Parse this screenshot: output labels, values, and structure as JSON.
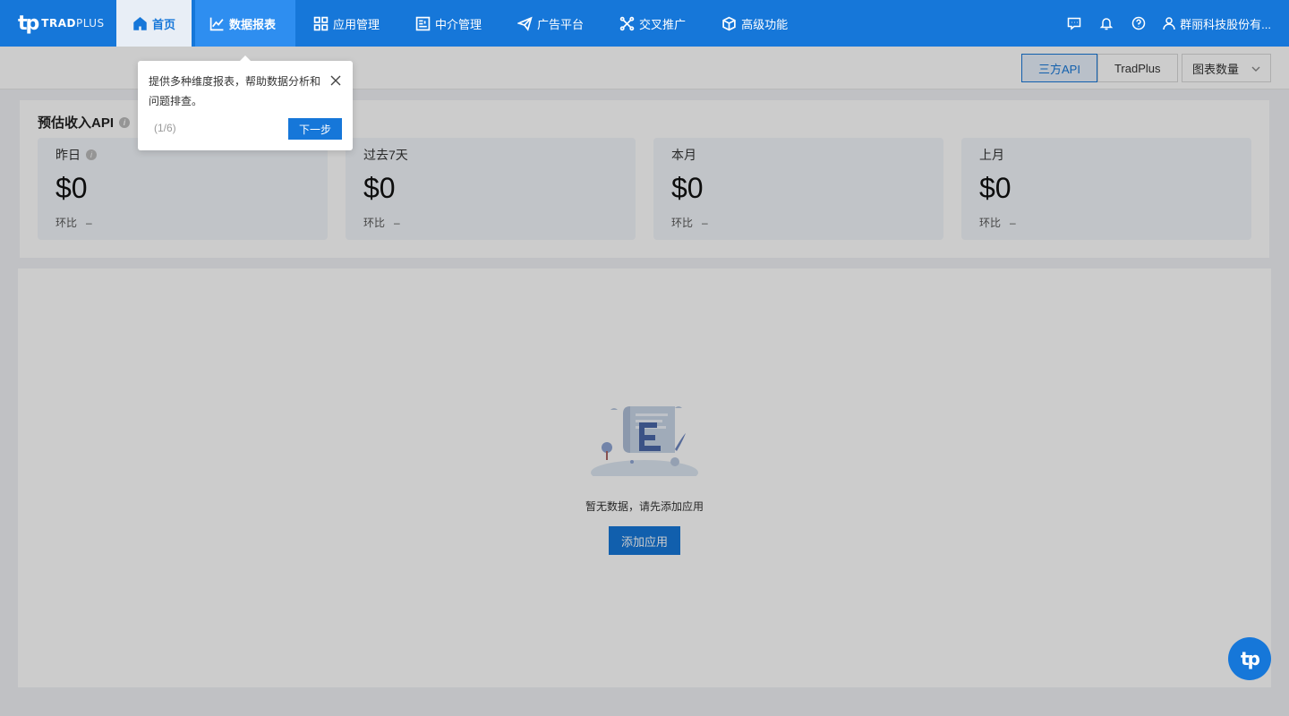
{
  "brand": {
    "mark": "tp",
    "name_bold": "TRAD",
    "name_rest": "PLUS"
  },
  "nav": {
    "items": [
      {
        "key": "home",
        "label": "首页"
      },
      {
        "key": "reports",
        "label": "数据报表"
      },
      {
        "key": "apps",
        "label": "应用管理"
      },
      {
        "key": "mediation",
        "label": "中介管理"
      },
      {
        "key": "ad_platform",
        "label": "广告平台"
      },
      {
        "key": "cross_promo",
        "label": "交叉推广"
      },
      {
        "key": "advanced",
        "label": "高级功能"
      }
    ],
    "user_name": "群丽科技股份有..."
  },
  "filter": {
    "segments": [
      "三方API",
      "TradPlus"
    ],
    "selected_segment": "三方API",
    "select_value": "图表数量"
  },
  "revenue": {
    "title": "预估收入API",
    "cards": [
      {
        "label": "昨日",
        "value": "$0",
        "cmp_label": "环比",
        "cmp_value": "–"
      },
      {
        "label": "过去7天",
        "value": "$0",
        "cmp_label": "环比",
        "cmp_value": "–"
      },
      {
        "label": "本月",
        "value": "$0",
        "cmp_label": "环比",
        "cmp_value": "–"
      },
      {
        "label": "上月",
        "value": "$0",
        "cmp_label": "环比",
        "cmp_value": "–"
      }
    ]
  },
  "empty": {
    "message": "暂无数据，请先添加应用",
    "button": "添加应用"
  },
  "tour": {
    "text": "提供多种维度报表，帮助数据分析和问题排查。",
    "step": "(1/6)",
    "next": "下一步"
  },
  "float_button": {
    "mark": "tp"
  },
  "colors": {
    "primary": "#1677d9",
    "nav_active": "#2e8ef0",
    "card_bg": "#f2f6fb"
  }
}
